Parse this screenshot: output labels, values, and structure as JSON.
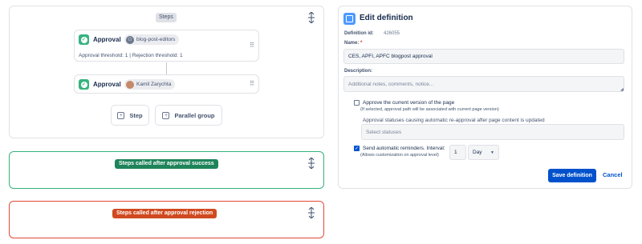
{
  "steps_panel": {
    "title": "Steps",
    "steps": [
      {
        "label": "Approval",
        "assignee": "blog-post-editors",
        "thresholds": "Approval threshold: 1 | Rejection threshold: 1"
      },
      {
        "label": "Approval",
        "assignee": "Kamil Zarychta"
      }
    ],
    "add_step_label": "Step",
    "add_parallel_label": "Parallel group"
  },
  "success_panel": {
    "label": "Steps called after approval success",
    "color": "#1f845a"
  },
  "rejection_panel": {
    "label": "Steps called after approval rejection",
    "color": "#d04a1f"
  },
  "edit_definition": {
    "title": "Edit definition",
    "definition_id_label": "Definition id:",
    "definition_id": "426055",
    "name_label": "Name:",
    "name_required": "*",
    "name_value": "CES, APFI, APFC blogpost approval",
    "description_label": "Description:",
    "description_placeholder": "Additional notes, comments, notice...",
    "approve_current_label": "Approve the current version of the page",
    "approve_current_hint": "(If selected, approval path will be associated with current page version)",
    "approve_current_checked": false,
    "statuses_label": "Approval statuses causing automatic re-approval after page content is updated",
    "statuses_placeholder": "Select statuses",
    "reminders_label": "Send automatic reminders. Interval:",
    "reminders_hint": "(Allows customization on approval level)",
    "reminders_checked": true,
    "interval_value": "1",
    "interval_unit": "Day",
    "save_label": "Save definition",
    "cancel_label": "Cancel",
    "accent_color": "#0052cc"
  }
}
